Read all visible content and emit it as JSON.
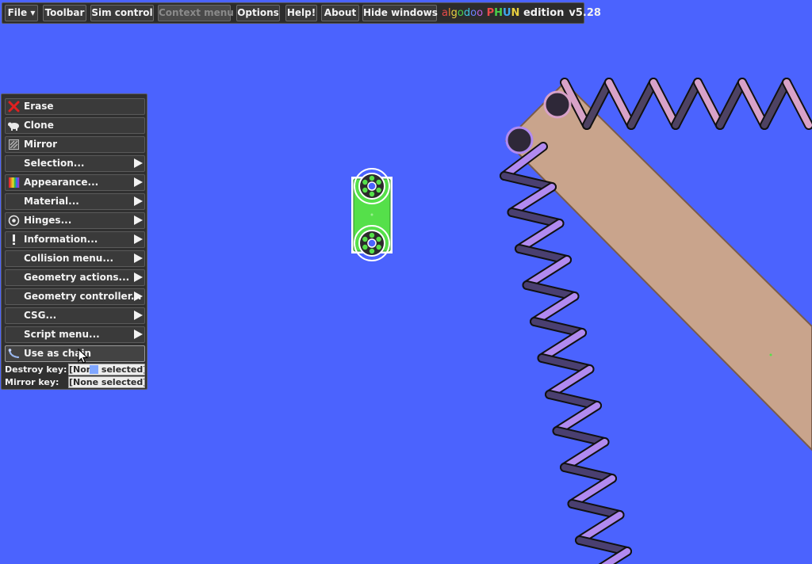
{
  "menubar": {
    "items": [
      {
        "label": "File ▾"
      },
      {
        "label": "Toolbar"
      },
      {
        "label": "Sim control"
      },
      {
        "label": "Context menu"
      },
      {
        "label": "Options"
      },
      {
        "label": "Help!"
      },
      {
        "label": "About"
      },
      {
        "label": "Hide windows"
      }
    ],
    "brand_letters": [
      {
        "ch": "a",
        "color": "#e84a4a"
      },
      {
        "ch": "l",
        "color": "#f08a30"
      },
      {
        "ch": "g",
        "color": "#e8d040"
      },
      {
        "ch": "o",
        "color": "#4ad04a"
      },
      {
        "ch": "d",
        "color": "#40c8e0"
      },
      {
        "ch": "o",
        "color": "#6a80ff"
      },
      {
        "ch": "o",
        "color": "#c060e0"
      }
    ],
    "phun_letters": [
      {
        "ch": "P",
        "color": "#e84a4a"
      },
      {
        "ch": "H",
        "color": "#4ad04a"
      },
      {
        "ch": "U",
        "color": "#40a8f0"
      },
      {
        "ch": "N",
        "color": "#e8d040"
      }
    ],
    "edition": "edition",
    "version": "v5.28"
  },
  "context_menu": {
    "items": [
      {
        "label": "Erase",
        "icon": "erase-icon"
      },
      {
        "label": "Clone",
        "icon": "clone-icon"
      },
      {
        "label": "Mirror",
        "icon": "mirror-icon"
      },
      {
        "label": "Selection...",
        "icon": ""
      },
      {
        "label": "Appearance...",
        "icon": "appearance-icon"
      },
      {
        "label": "Material...",
        "icon": ""
      },
      {
        "label": "Hinges...",
        "icon": "hinge-icon"
      },
      {
        "label": "Information...",
        "icon": "info-icon"
      },
      {
        "label": "Collision menu...",
        "icon": ""
      },
      {
        "label": "Geometry actions...",
        "icon": ""
      },
      {
        "label": "Geometry controller...",
        "icon": ""
      },
      {
        "label": "CSG...",
        "icon": ""
      },
      {
        "label": "Script menu...",
        "icon": ""
      },
      {
        "label": "Use as chain",
        "icon": "chain-icon"
      }
    ],
    "destroy_key": {
      "label": "Destroy key:",
      "value": "[None selected]"
    },
    "mirror_key": {
      "label": "Mirror key:",
      "value": "[None selected]"
    }
  },
  "colors": {
    "background": "#4b63fe",
    "plank": "#c9a48c",
    "spring_pink": "#d8a2c8",
    "spring_purple": "#b18af0",
    "green_box": "#55e04a"
  }
}
